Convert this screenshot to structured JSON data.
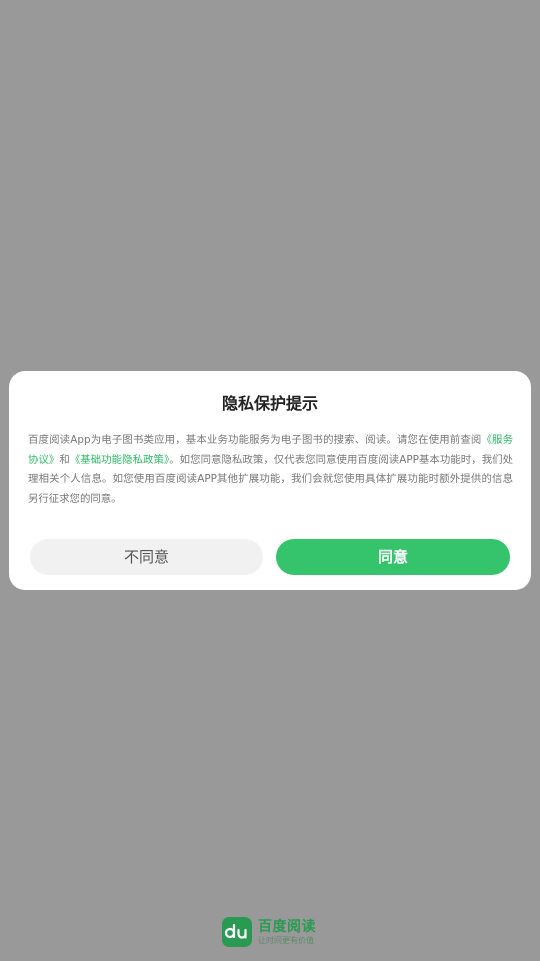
{
  "dialog": {
    "title": "隐私保护提示",
    "body": {
      "text_1": "百度阅读App为电子图书类应用，基本业务功能服务为电子图书的搜索、阅读。请您在使用前查阅",
      "link_service": "《服务协议》",
      "text_2": "和",
      "link_privacy": "《基础功能隐私政策》",
      "text_3": "。如您同意隐私政策，仅代表您同意使用百度阅读APP基本功能时，我们处理相关个人信息。如您使用百度阅读APP其他扩展功能，我们会就您使用具体扩展功能时额外提供的信息另行征求您的同意。"
    },
    "disagree_label": "不同意",
    "agree_label": "同意"
  },
  "brand": {
    "logo_icon": "du-logo-icon",
    "name": "百度阅读",
    "slogan": "让时间更有价值"
  },
  "colors": {
    "overlay": "#999999",
    "accent": "#35c46c",
    "link": "#2eb866",
    "brand": "#2a9a52"
  }
}
